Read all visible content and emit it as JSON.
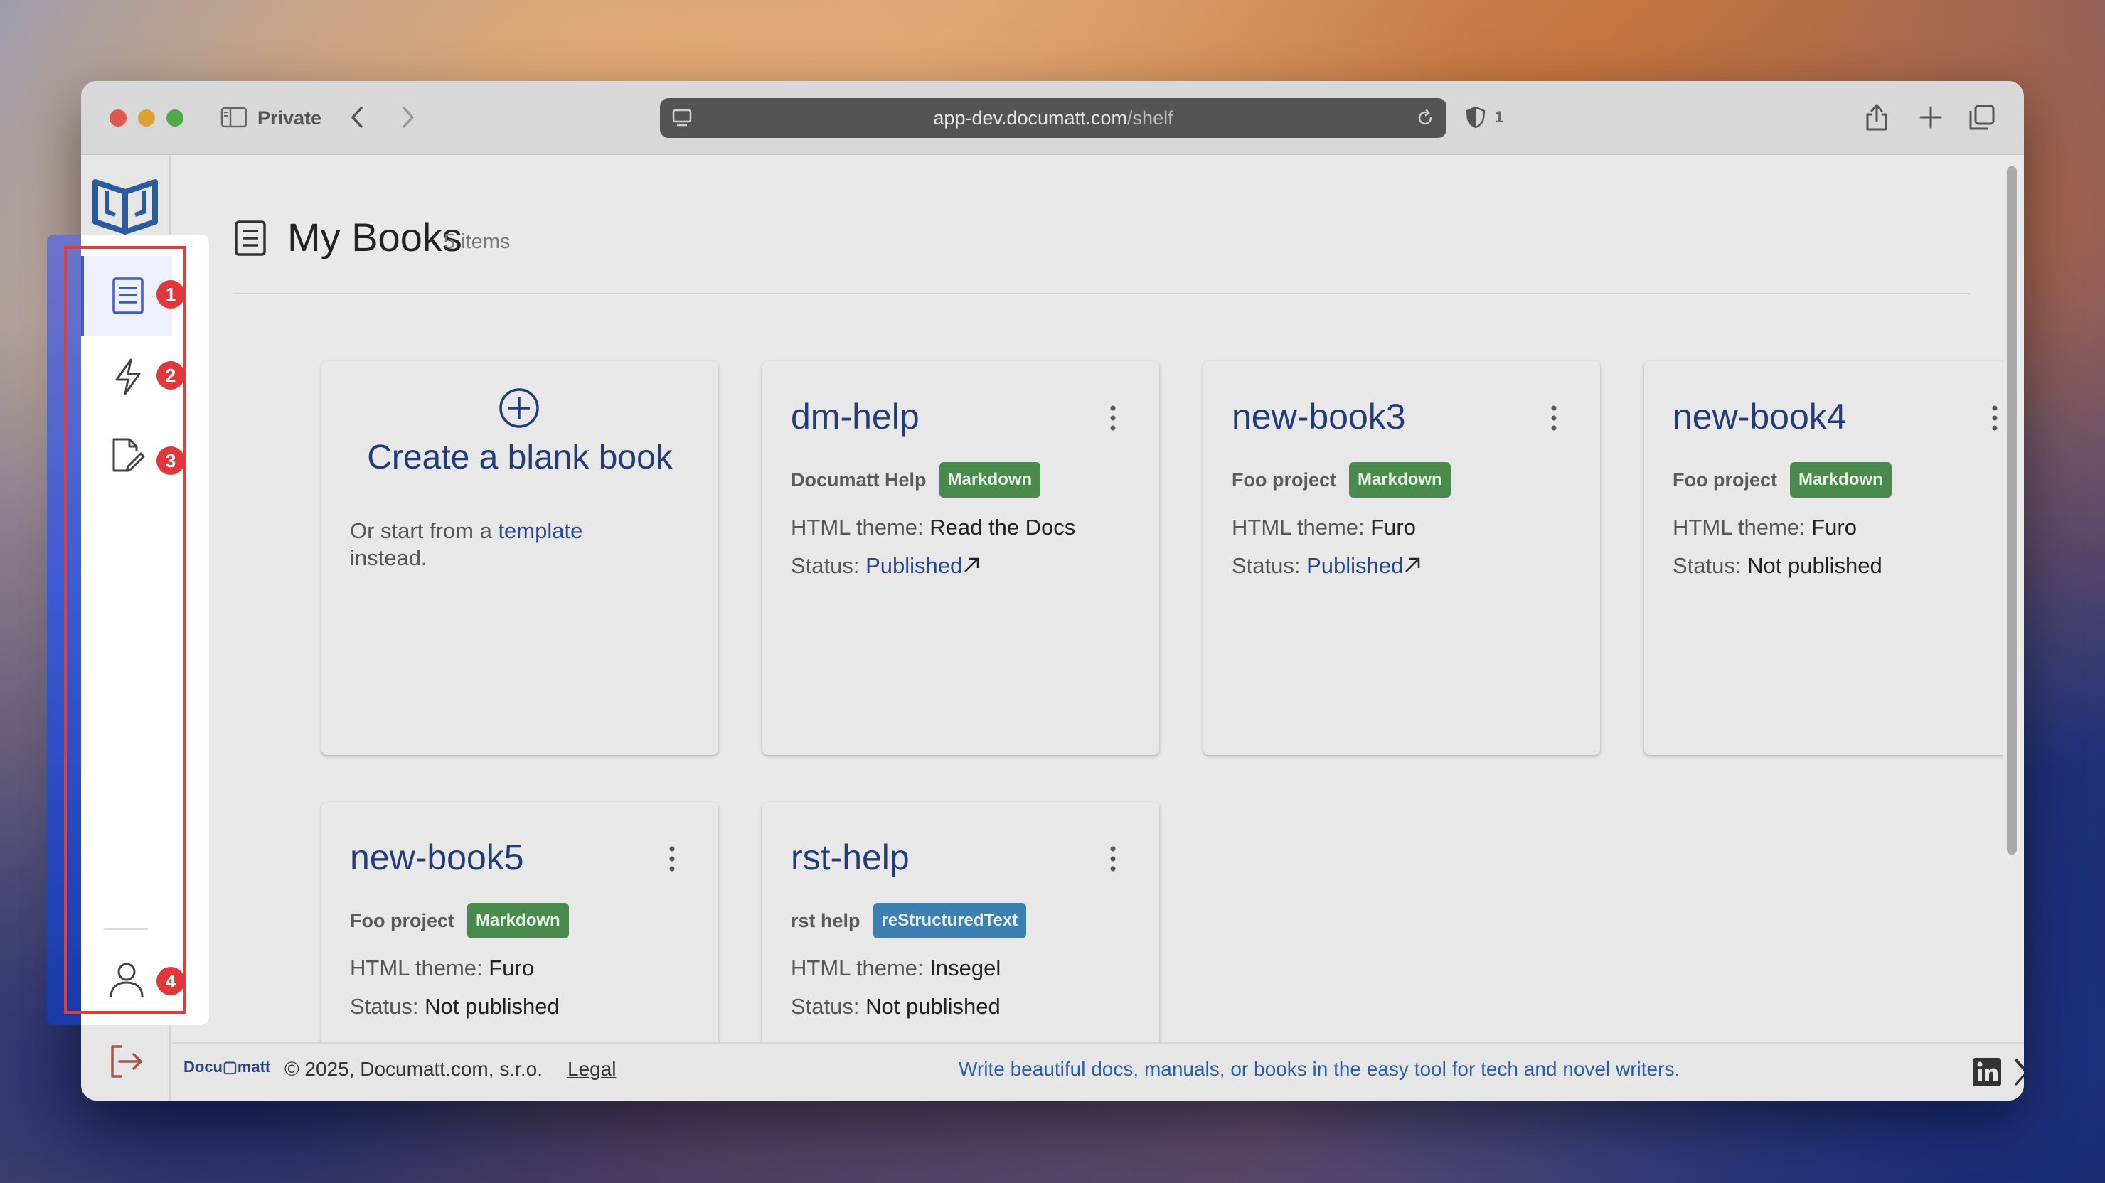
{
  "browser": {
    "private_label": "Private",
    "url_domain": "app-dev.documatt.com",
    "url_path": "/shelf",
    "shield_count": "1"
  },
  "page": {
    "title": "My Books",
    "item_count": "5 items"
  },
  "create_card": {
    "title": "Create a blank book",
    "sub_prefix": "Or start from a",
    "sub_link": "template",
    "sub_suffix": "instead."
  },
  "labels": {
    "theme": "HTML theme:",
    "status": "Status:"
  },
  "books": [
    {
      "title": "dm-help",
      "project": "Documatt Help",
      "format": "Markdown",
      "theme": "Read the Docs",
      "status": "Published",
      "published": true
    },
    {
      "title": "new-book3",
      "project": "Foo project",
      "format": "Markdown",
      "theme": "Furo",
      "status": "Published",
      "published": true
    },
    {
      "title": "new-book4",
      "project": "Foo project",
      "format": "Markdown",
      "theme": "Furo",
      "status": "Not published",
      "published": false
    },
    {
      "title": "new-book5",
      "project": "Foo project",
      "format": "Markdown",
      "theme": "Furo",
      "status": "Not published",
      "published": false
    },
    {
      "title": "rst-help",
      "project": "rst help",
      "format": "reStructuredText",
      "theme": "Insegel",
      "status": "Not published",
      "published": false
    }
  ],
  "sidebar_badges": [
    "1",
    "2",
    "3",
    "4"
  ],
  "footer": {
    "logo": "Docu▢matt",
    "copyright": "© 2025, Documatt.com, s.r.o.",
    "legal": "Legal",
    "tagline": "Write beautiful docs, manuals, or books in the easy tool for tech and novel writers."
  },
  "colors": {
    "accent": "#243b7a",
    "markdown_badge": "#4a8a4c",
    "rst_badge": "#3d7fb0",
    "highlight": "#e23c3c"
  }
}
